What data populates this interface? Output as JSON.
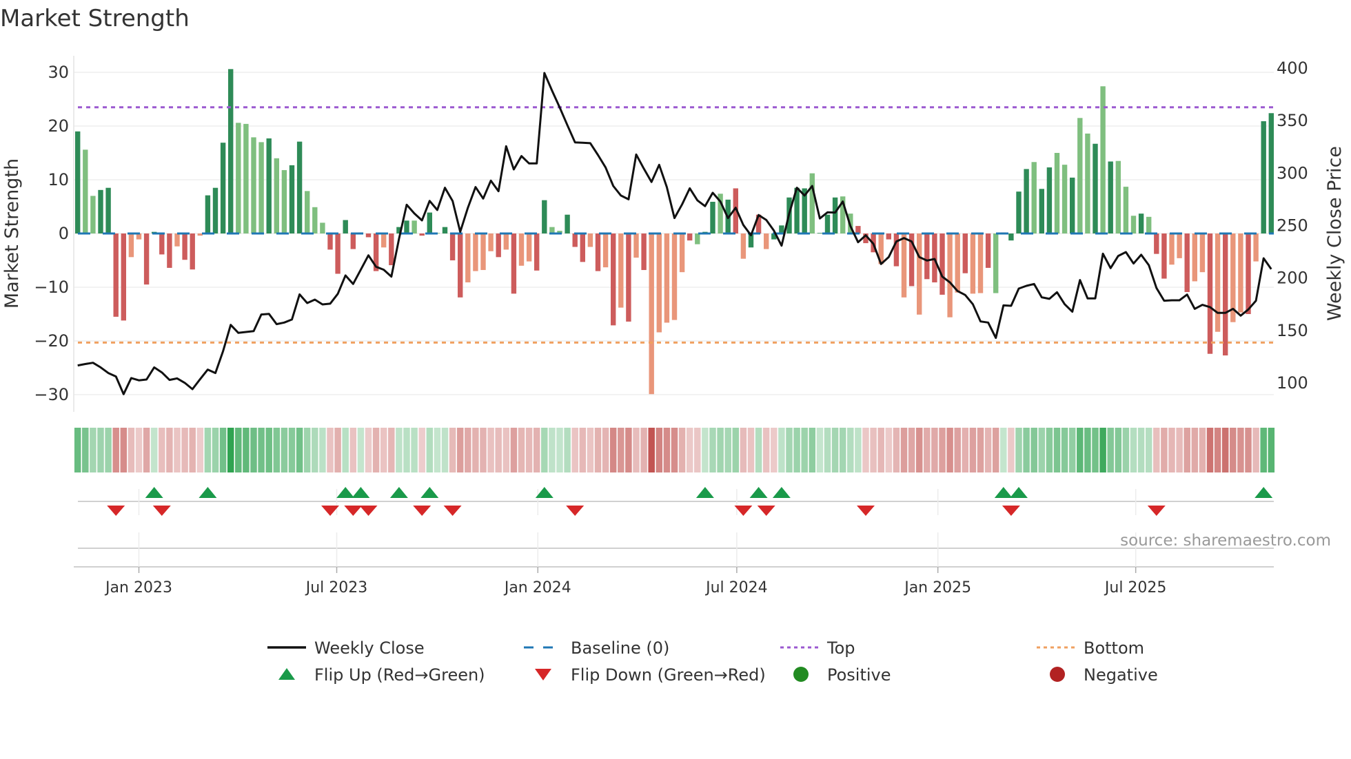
{
  "chart_data": {
    "type": "bar",
    "title": "Market Strength",
    "ylabel": "Market Strength",
    "y2label": "Weekly Close Price",
    "ylim": [
      -33,
      33
    ],
    "y2lim": [
      80,
      410
    ],
    "yticks": [
      "30",
      "20",
      "10",
      "0",
      "−10",
      "−20",
      "−30"
    ],
    "ytick_values": [
      30,
      20,
      10,
      0,
      -10,
      -20,
      -30
    ],
    "y2ticks": [
      "400",
      "350",
      "300",
      "250",
      "200",
      "150",
      "100"
    ],
    "y2tick_values": [
      400,
      350,
      300,
      250,
      200,
      150,
      100
    ],
    "x_start": "2022-11-06",
    "x_step_days": 7,
    "xticks": [
      {
        "label": "Jan 2023",
        "date": "2023-01-01"
      },
      {
        "label": "Jul 2023",
        "date": "2023-07-01"
      },
      {
        "label": "Jan 2024",
        "date": "2024-01-01"
      },
      {
        "label": "Jul 2024",
        "date": "2024-07-01"
      },
      {
        "label": "Jan 2025",
        "date": "2025-01-01"
      },
      {
        "label": "Jul 2025",
        "date": "2025-07-01"
      }
    ],
    "top_level": 23.5,
    "bottom_level": -20.3,
    "baseline": 0,
    "strength": [
      19.0,
      15.6,
      7.0,
      8.1,
      8.5,
      -15.5,
      -16.2,
      -4.4,
      -1.1,
      -9.5,
      0.3,
      -3.9,
      -6.4,
      -2.4,
      -4.9,
      -6.7,
      -0.4,
      7.1,
      8.5,
      16.9,
      30.6,
      20.6,
      20.4,
      17.9,
      17.0,
      17.7,
      14.0,
      11.8,
      12.7,
      17.1,
      7.9,
      4.9,
      2.0,
      -3.0,
      -7.5,
      2.5,
      -2.9,
      0.2,
      -0.7,
      -7.0,
      -2.6,
      -5.9,
      1.2,
      2.4,
      2.4,
      -0.4,
      3.9,
      0.1,
      1.2,
      -5.0,
      -11.9,
      -9.1,
      -7.0,
      -6.8,
      -3.3,
      -4.4,
      -3.0,
      -11.2,
      -6.0,
      -5.2,
      -6.9,
      6.2,
      1.2,
      0.5,
      3.5,
      -2.5,
      -5.3,
      -2.5,
      -7.0,
      -6.3,
      -17.1,
      -13.8,
      -16.4,
      -4.5,
      -6.8,
      -29.9,
      -18.4,
      -16.6,
      -16.1,
      -7.2,
      -1.3,
      -2.0,
      0.3,
      5.9,
      7.4,
      6.3,
      8.4,
      -4.7,
      -2.6,
      3.5,
      -2.9,
      -1.1,
      1.5,
      6.7,
      8.5,
      8.4,
      11.2,
      0.1,
      3.5,
      6.7,
      6.9,
      3.7,
      1.4,
      -1.8,
      -3.5,
      -5.7,
      -1.1,
      -6.1,
      -11.9,
      -9.8,
      -15.1,
      -8.5,
      -9.1,
      -11.4,
      -15.6,
      -11.0,
      -7.4,
      -11.2,
      -11.1,
      -6.4,
      -11.1,
      0.2,
      -1.3,
      7.8,
      12.0,
      13.3,
      8.3,
      12.3,
      15.0,
      12.8,
      10.4,
      21.5,
      18.6,
      16.7,
      27.4,
      13.4,
      13.5,
      8.7,
      3.3,
      3.7,
      3.1,
      -3.8,
      -8.4,
      -5.8,
      -4.6,
      -10.9,
      -8.9,
      -7.2,
      -22.4,
      -18.3,
      -22.7,
      -16.5,
      -14.7,
      -15.0,
      -5.2,
      20.9,
      22.4
    ],
    "strength_shade": "GggGGRRrrRGRRrRRrGGGGggggGggGGgggRRGRgRRrRGGgRGgGRRrrrrRrRrrRGggGRRrRrRrRrRrrrrrRgGGgGRrGRrGGGGGgGGGggRRRrRRrRrRRRrrRrrRgRGGGgGGggGggGgGgggGgRRrrRrrRrRrrRrGG",
    "close": [
      116.6,
      118.0,
      119.2,
      114.8,
      109.4,
      106.1,
      89.2,
      104.6,
      102.4,
      103.2,
      114.8,
      110.0,
      102.8,
      104.3,
      100.0,
      94.0,
      103.5,
      112.7,
      109.4,
      130.2,
      155.3,
      147.7,
      148.5,
      149.4,
      165.2,
      165.8,
      156.0,
      157.5,
      160.4,
      184.4,
      176.1,
      179.4,
      174.8,
      175.5,
      184.9,
      202.4,
      194.3,
      207.9,
      221.6,
      210.7,
      207.9,
      201.3,
      237.4,
      269.8,
      261.5,
      254.9,
      273.5,
      264.8,
      286.0,
      273.5,
      244.0,
      267.0,
      286.7,
      275.7,
      292.8,
      282.7,
      325.6,
      303.5,
      316.2,
      309.2,
      309.2,
      395.4,
      378.6,
      362.6,
      345.7,
      329.3,
      328.9,
      328.5,
      317.3,
      305.3,
      287.7,
      278.6,
      275.0,
      317.7,
      304.2,
      291.5,
      307.9,
      286.7,
      257.1,
      270.2,
      285.5,
      274.0,
      268.5,
      281.2,
      272.9,
      257.1,
      267.0,
      250.5,
      240.7,
      260.0,
      255.3,
      245.1,
      230.8,
      261.5,
      286.0,
      278.6,
      287.7,
      256.7,
      262.6,
      262.4,
      272.9,
      249.4,
      234.1,
      240.7,
      232.6,
      213.3,
      219.9,
      234.8,
      238.1,
      234.8,
      219.9,
      216.6,
      218.1,
      201.3,
      195.8,
      187.5,
      183.8,
      175.0,
      158.6,
      157.5,
      142.9,
      173.9,
      173.5,
      189.9,
      192.5,
      194.3,
      181.6,
      180.1,
      186.4,
      175.0,
      167.8,
      198.0,
      180.5,
      180.5,
      223.2,
      209.4,
      221.0,
      224.7,
      213.8,
      222.1,
      212.2,
      190.4,
      178.3,
      178.7,
      178.7,
      184.2,
      170.6,
      174.4,
      172.2,
      166.7,
      166.7,
      170.6,
      164.1,
      170.0,
      178.3,
      218.8,
      208.5
    ],
    "legend": {
      "placement": "bottom",
      "items": [
        {
          "label": "Weekly Close",
          "kind": "line"
        },
        {
          "label": "Baseline (0)",
          "kind": "dash"
        },
        {
          "label": "Top",
          "kind": "dot-top"
        },
        {
          "label": "Bottom",
          "kind": "dot-bottom"
        },
        {
          "label": "Flip Up (Red→Green)",
          "kind": "tri-up"
        },
        {
          "label": "Flip Down (Green→Red)",
          "kind": "tri-down"
        },
        {
          "label": "Positive",
          "kind": "dot-pos"
        },
        {
          "label": "Negative",
          "kind": "dot-neg"
        }
      ]
    },
    "source": "source: sharemaestro.com",
    "colors": {
      "green_dark": "#2e8b57",
      "green_light": "#7fbf7f",
      "red_dark": "#cd5c5c",
      "red_light": "#e9967a",
      "close_line": "#111111",
      "baseline": "#1f77b4",
      "top": "#9b59d0",
      "bottom": "#f0a060",
      "flip_up": "#1a9a4a",
      "flip_down": "#d62728",
      "positive": "#228b22",
      "negative": "#b22222"
    }
  }
}
